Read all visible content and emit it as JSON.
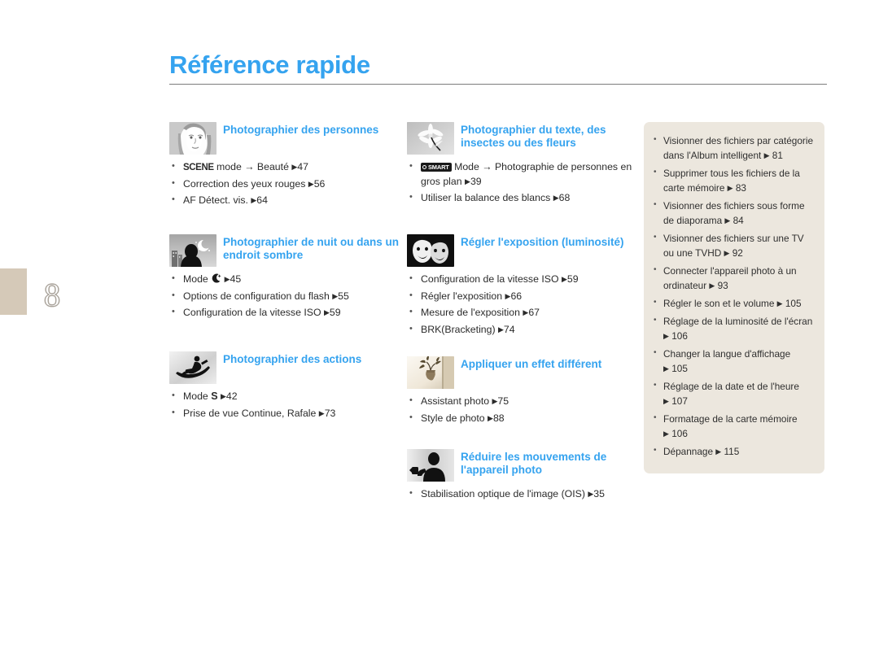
{
  "page": {
    "number": "8",
    "title": "Référence rapide"
  },
  "columns": [
    {
      "id": "column-1",
      "sections": [
        {
          "icon": "portrait-photo-icon",
          "title": "Photographier des personnes",
          "items": [
            {
              "badge": "SCENE",
              "text": " mode → Beauté",
              "page": "47"
            },
            {
              "text": "Correction des yeux rouges",
              "page": "56"
            },
            {
              "text": "AF Détect. vis.",
              "page": "64"
            }
          ]
        },
        {
          "icon": "night-scene-icon",
          "title": "Photographier de nuit ou dans un endroit sombre",
          "items": [
            {
              "badge": "MOON",
              "text": "Mode ",
              "page": "45"
            },
            {
              "text": "Options de configuration du flash",
              "page": "55"
            },
            {
              "text": "Configuration de la vitesse ISO",
              "page": "59"
            }
          ]
        },
        {
          "icon": "snowboarder-action-icon",
          "title": "Photographier des actions",
          "items": [
            {
              "badge": "S",
              "text": "Mode ",
              "page": "42"
            },
            {
              "text": "Prise de vue Continue, Rafale",
              "page": "73"
            }
          ]
        }
      ]
    },
    {
      "id": "column-2",
      "sections": [
        {
          "icon": "flower-macro-icon",
          "title": "Photographier du texte, des insectes ou des fleurs",
          "items": [
            {
              "badge": "SMART",
              "text": " Mode → Photographie de personnes en gros plan",
              "page": "39"
            },
            {
              "text": "Utiliser la balance des blancs",
              "page": "68"
            }
          ]
        },
        {
          "icon": "two-faces-exposure-icon",
          "title": "Régler l'exposition (luminosité)",
          "items": [
            {
              "text": "Configuration de la vitesse ISO",
              "page": "59"
            },
            {
              "text": "Régler l'exposition",
              "page": "66"
            },
            {
              "text": "Mesure de l'exposition",
              "page": "67"
            },
            {
              "text": "BRK(Bracketing)",
              "page": "74"
            }
          ]
        },
        {
          "icon": "vase-effect-icon",
          "title": "Appliquer un effet différent",
          "items": [
            {
              "text": "Assistant photo",
              "page": "75"
            },
            {
              "text": "Style de photo",
              "page": "88"
            }
          ]
        },
        {
          "icon": "camera-shake-icon",
          "title": "Réduire les mouvements de l'appareil photo",
          "items": [
            {
              "text": "Stabilisation optique de l'image (OIS)",
              "page": "35"
            }
          ]
        }
      ]
    }
  ],
  "right_panel": {
    "items": [
      {
        "text": "Visionner des fichiers par catégorie dans l'Album intelligent",
        "page": "81"
      },
      {
        "text": "Supprimer tous les fichiers de la carte mémoire",
        "page": "83"
      },
      {
        "text": "Visionner des fichiers sous forme de diaporama",
        "page": "84"
      },
      {
        "text": "Visionner des fichiers sur une TV ou une TVHD",
        "page": "92"
      },
      {
        "text": "Connecter l'appareil photo à un ordinateur",
        "page": "93"
      },
      {
        "text": "Régler le son et le volume",
        "page": "105"
      },
      {
        "text": "Réglage de la luminosité de l'écran",
        "page": "106"
      },
      {
        "text": "Changer la langue d'affichage",
        "page": "105"
      },
      {
        "text": "Réglage de la date et de l'heure",
        "page": "107"
      },
      {
        "text": "Formatage de la carte mémoire",
        "page": "106"
      },
      {
        "text": "Dépannage",
        "page": "115"
      }
    ]
  },
  "colors": {
    "accent": "#35a3ef",
    "panel_bg": "#ece7de",
    "tab_bg": "#d5c9b8",
    "text": "#2b2b2b",
    "rule": "#7c7c7c"
  }
}
